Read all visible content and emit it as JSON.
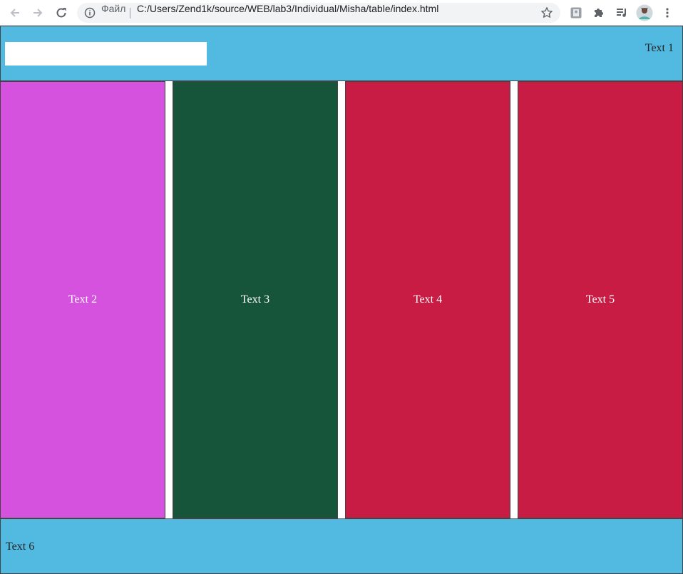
{
  "browser": {
    "scheme_label": "Файл",
    "url": "C:/Users/Zend1k/source/WEB/lab3/Individual/Misha/table/index.html"
  },
  "header": {
    "input_value": "",
    "text": "Text 1",
    "bg_color": "#52bae0"
  },
  "columns": [
    {
      "text": "Text 2",
      "color": "#d552df"
    },
    {
      "text": "Text 3",
      "color": "#16553a"
    },
    {
      "text": "Text 4",
      "color": "#c81c44"
    },
    {
      "text": "Text 5",
      "color": "#c81c44"
    }
  ],
  "footer": {
    "text": "Text 6",
    "bg_color": "#52bae0"
  }
}
